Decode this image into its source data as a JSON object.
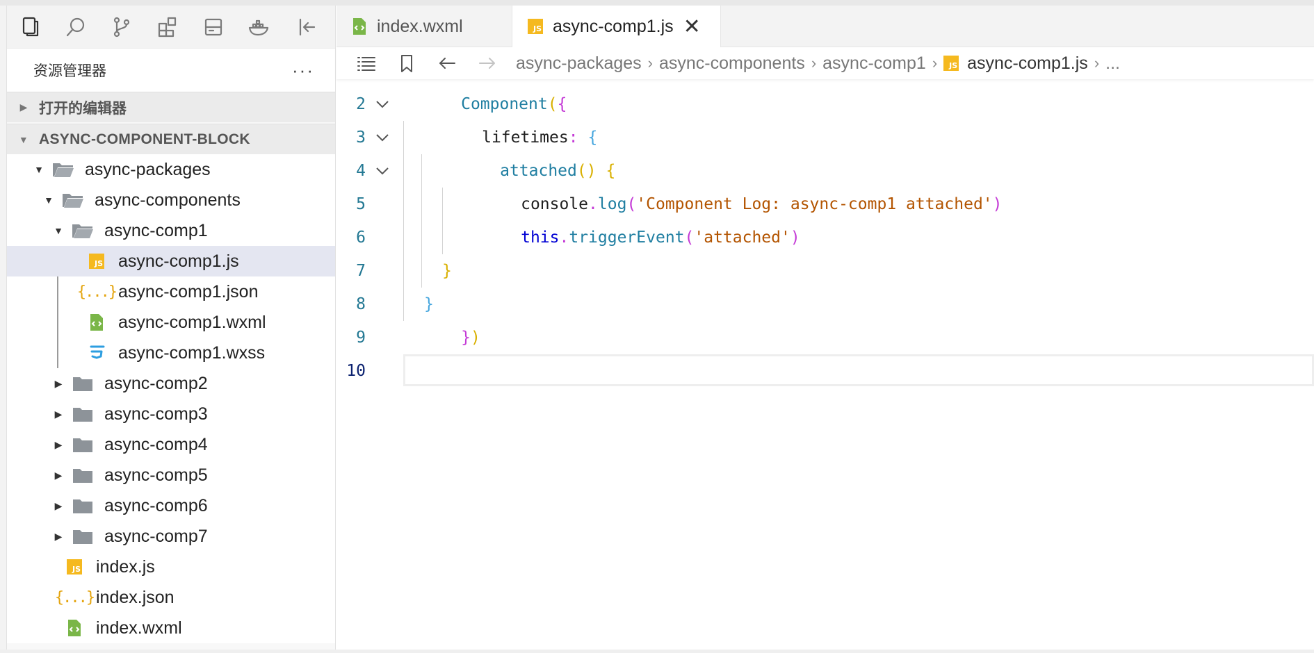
{
  "activity_bar": {
    "icons": [
      "explorer-icon",
      "search-icon",
      "source-control-icon",
      "extensions-icon",
      "database-icon",
      "docker-icon",
      "collapse-panel-icon"
    ]
  },
  "explorer": {
    "title": "资源管理器",
    "more": "···",
    "open_editors_label": "打开的编辑器",
    "project_label": "ASYNC-COMPONENT-BLOCK",
    "tree": {
      "async_packages": "async-packages",
      "async_components": "async-components",
      "async_comp1": "async-comp1",
      "comp1_js": "async-comp1.js",
      "comp1_json": "async-comp1.json",
      "comp1_wxml": "async-comp1.wxml",
      "comp1_wxss": "async-comp1.wxss",
      "comp2": "async-comp2",
      "comp3": "async-comp3",
      "comp4": "async-comp4",
      "comp5": "async-comp5",
      "comp6": "async-comp6",
      "comp7": "async-comp7",
      "index_js": "index.js",
      "index_json": "index.json",
      "index_wxml": "index.wxml"
    },
    "js_badge": "JS",
    "json_badge": "{...}"
  },
  "tabs": {
    "tab1": "index.wxml",
    "tab2": "async-comp1.js",
    "close": "✕"
  },
  "breadcrumb": {
    "c1": "async-packages",
    "c2": "async-components",
    "c3": "async-comp1",
    "c4": "async-comp1.js",
    "c5": "...",
    "sep": "›"
  },
  "code": {
    "line_numbers": [
      "2",
      "3",
      "4",
      "5",
      "6",
      "7",
      "8",
      "9",
      "10"
    ],
    "l2_fn": "Component",
    "l2_p1": "(",
    "l2_p2": "{",
    "l3_prop": "lifetimes",
    "l3_colon": ":",
    "l3_brace": "{",
    "l4_fn": "attached",
    "l4_parens": "()",
    "l4_brace": "{",
    "l5_obj": "console",
    "l5_dot": ".",
    "l5_fn": "log",
    "l5_open": "(",
    "l5_str": "'Component Log: async-comp1 attached'",
    "l5_close": ")",
    "l6_this": "this",
    "l6_dot": ".",
    "l6_fn": "triggerEvent",
    "l6_open": "(",
    "l6_str": "'attached'",
    "l6_close": ")",
    "l7_brace": "}",
    "l8_brace": "}",
    "l9_brace": "}",
    "l9_paren": ")"
  }
}
